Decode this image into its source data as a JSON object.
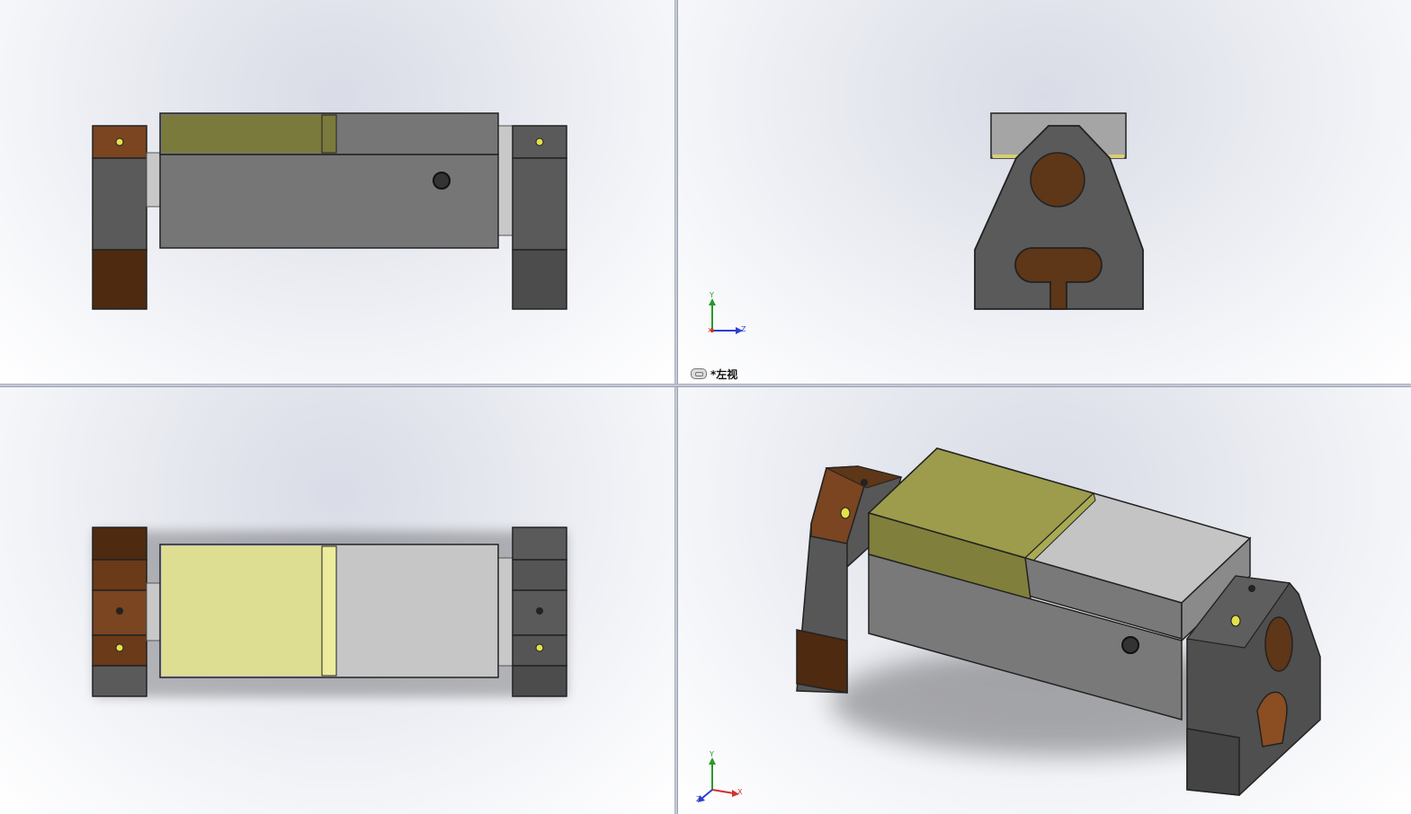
{
  "viewports": {
    "top_left": {
      "name": ""
    },
    "top_right": {
      "name": "*左视",
      "triad_axes": [
        "Y",
        "Z",
        "X"
      ]
    },
    "bottom_left": {
      "name": ""
    },
    "bottom_right": {
      "name": "",
      "triad_axes": [
        "Y",
        "Z",
        "X"
      ]
    }
  },
  "colors": {
    "body_gray": "#767676",
    "dark_gray": "#4c4c4c",
    "light_gray": "#c4c4c4",
    "olive": "#7a7a3c",
    "olive_light": "#dede92",
    "brown": "#7a4520",
    "dark_brown": "#4e2a10",
    "hole_yellow": "#e4e04a",
    "axis_y": "#2a9a2a",
    "axis_z": "#2c3fd1",
    "axis_x": "#d23030"
  },
  "icons": [
    "link-icon",
    "coordinate-triad-icon"
  ]
}
